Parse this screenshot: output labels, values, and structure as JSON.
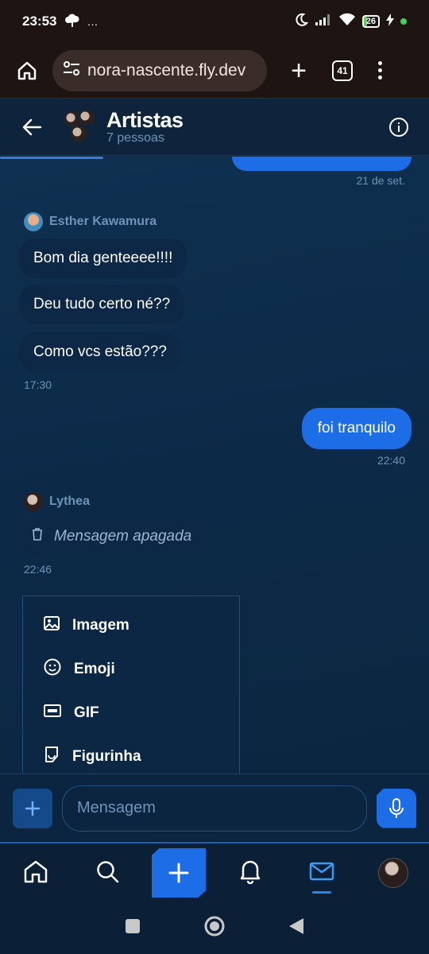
{
  "status_bar": {
    "time": "23:53",
    "extra": "…",
    "battery": "26"
  },
  "browser": {
    "url": "nora-nascente.fly.dev",
    "tab_count": "41"
  },
  "header": {
    "title": "Artistas",
    "subtitle": "7 pessoas"
  },
  "chat": {
    "previous_date": "21 de set.",
    "groups": [
      {
        "sender": "Esther Kawamura",
        "messages": [
          "Bom dia genteeee!!!!",
          "Deu tudo certo né??",
          "Como vcs estão???"
        ],
        "time": "17:30"
      }
    ],
    "outgoing": {
      "text": "foi tranquilo",
      "time": "22:40"
    },
    "deleted_group": {
      "sender": "Lythea",
      "text": "Mensagem apagada",
      "time": "22:46"
    }
  },
  "attach_menu": {
    "items": [
      {
        "label": "Imagem",
        "icon": "image-icon"
      },
      {
        "label": "Emoji",
        "icon": "emoji-icon"
      },
      {
        "label": "GIF",
        "icon": "gif-icon"
      },
      {
        "label": "Figurinha",
        "icon": "sticker-icon"
      }
    ]
  },
  "composer": {
    "placeholder": "Mensagem"
  },
  "colors": {
    "accent": "#1d6ee6",
    "background": "#0e2a44",
    "muted_text": "#6f93b8"
  }
}
